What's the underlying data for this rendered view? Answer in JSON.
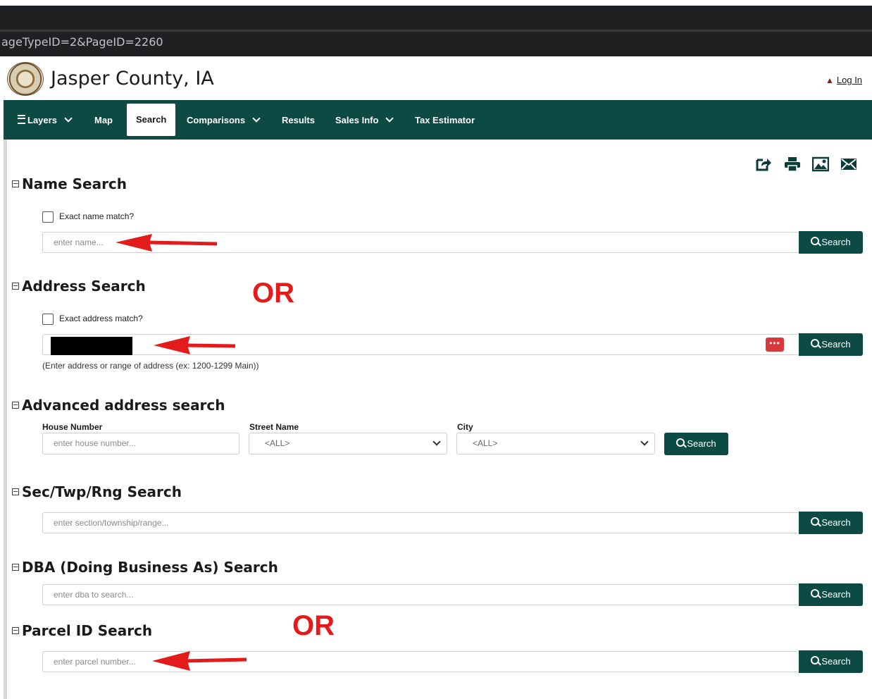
{
  "browser": {
    "url_fragment": "ageTypeID=2&PageID=2260"
  },
  "header": {
    "title": "Jasper County, IA",
    "login_label": "Log In"
  },
  "nav": {
    "items": [
      {
        "label": "Layers"
      },
      {
        "label": "Map"
      },
      {
        "label": "Search"
      },
      {
        "label": "Comparisons"
      },
      {
        "label": "Results"
      },
      {
        "label": "Sales Info"
      },
      {
        "label": "Tax Estimator"
      }
    ],
    "active": "Search"
  },
  "toolbar_icons": [
    "share-icon",
    "print-icon",
    "image-icon",
    "email-icon"
  ],
  "search_label": "Search",
  "sections": {
    "name": {
      "title": "Name Search",
      "checkbox_label": "Exact name match?",
      "placeholder": "enter name..."
    },
    "address": {
      "title": "Address Search",
      "checkbox_label": "Exact address match?",
      "hint": "(Enter address or range of address (ex: 1200-1299 Main))",
      "dots": "•••"
    },
    "advanced": {
      "title": "Advanced address search",
      "house_label": "House Number",
      "house_placeholder": "enter house number...",
      "street_label": "Street Name",
      "street_value": "<ALL>",
      "city_label": "City",
      "city_value": "<ALL>"
    },
    "sec": {
      "title": "Sec/Twp/Rng Search",
      "placeholder": "enter section/township/range..."
    },
    "dba": {
      "title": "DBA (Doing Business As) Search",
      "placeholder": "enter dba to search..."
    },
    "parcel": {
      "title": "Parcel ID Search",
      "placeholder": "enter parcel number..."
    }
  },
  "annotations": {
    "or_text": "OR",
    "color": "#e31b1b"
  },
  "colors": {
    "nav_bg": "#0d4a44",
    "button_bg": "#0d4a44"
  }
}
